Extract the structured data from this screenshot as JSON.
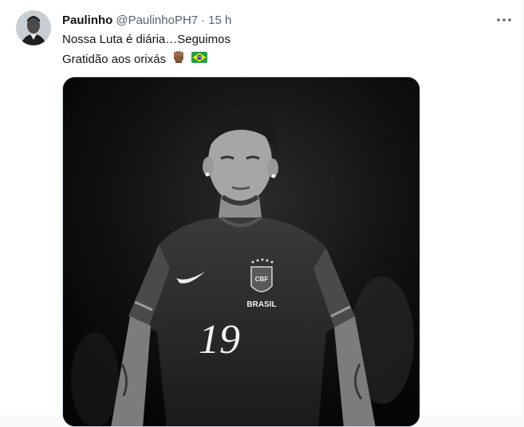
{
  "tweet": {
    "author_name": "Paulinho",
    "author_handle": "@PaulinhoPH7",
    "separator": "·",
    "time_ago": "15 h",
    "text_line1": "Nossa Luta é diária…Seguimos",
    "text_line2": "Gratidão aos orixás",
    "emojis": [
      "raised-fist-medium-dark-skin",
      "brazil-flag"
    ],
    "media": {
      "shirt_word": "BRASIL",
      "crest_text": "CBF",
      "shirt_number": "19"
    }
  },
  "icons": {
    "more": "more-horizontal-icon"
  }
}
